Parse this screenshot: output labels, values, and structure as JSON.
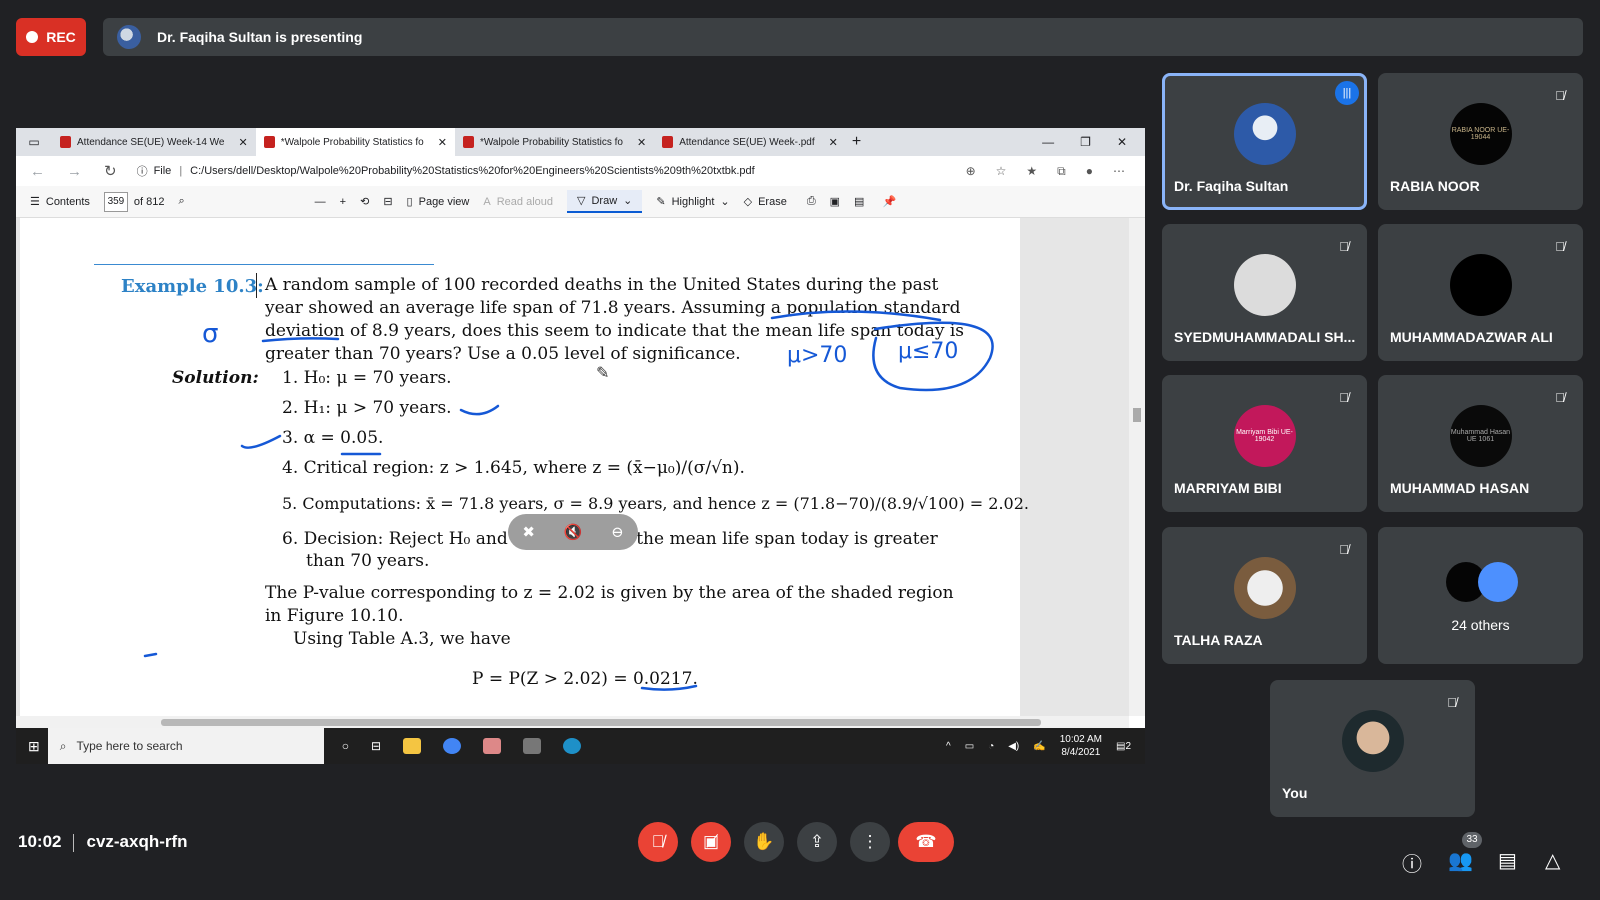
{
  "top": {
    "rec_label": "REC",
    "presenting_text": "Dr. Faqiha Sultan is presenting"
  },
  "browser": {
    "tabs": [
      {
        "label": "Attendance SE(UE) Week-14 We"
      },
      {
        "label": "*Walpole Probability Statistics fo"
      },
      {
        "label": "*Walpole Probability Statistics fo"
      },
      {
        "label": "Attendance SE(UE) Week-.pdf"
      }
    ],
    "address_prefix": "File",
    "url": "C:/Users/dell/Desktop/Walpole%20Probability%20Statistics%20for%20Engineers%20Scientists%209th%20txtbk.pdf"
  },
  "pdf_toolbar": {
    "contents": "Contents",
    "page": "359",
    "of_pages": "of 812",
    "page_view": "Page view",
    "read_aloud": "Read aloud",
    "draw": "Draw",
    "highlight": "Highlight",
    "erase": "Erase"
  },
  "document": {
    "example_heading": "Example 10.3:",
    "para1": [
      "A random sample of 100 recorded deaths in the United States during the past",
      "year showed an average life span of 71.8 years.  Assuming a population standard",
      "deviation of 8.9 years, does this seem to indicate that the mean life span today is",
      "greater than 70 years? Use a 0.05 level of significance."
    ],
    "solution_label": "Solution:",
    "steps": [
      "1.  H₀:  μ = 70 years.",
      "2.  H₁:  μ > 70 years.",
      "3.  α = 0.05.",
      "4.  Critical region: z > 1.645, where z = (x̄−μ₀)/(σ/√n).",
      "5.  Computations: x̄ = 71.8 years, σ = 8.9 years, and hence z = (71.8−70)/(8.9/√100) = 2.02.",
      "6.  Decision:  Reject H₀ and conclude that the mean life span today is greater",
      "than 70 years."
    ],
    "para2": [
      "The P-value corresponding to z = 2.02 is given by the area of the shaded region",
      "in Figure 10.10.",
      "Using Table A.3, we have"
    ],
    "formula": "P = P(Z > 2.02) = 0.0217.",
    "annotation_sigma": "σ",
    "annotation_mu1": "μ>70",
    "annotation_mu2": "μ≤70"
  },
  "taskbar": {
    "search_placeholder": "Type here to search",
    "time": "10:02 AM",
    "date": "8/4/2021",
    "notif_count": "2"
  },
  "participants": [
    {
      "name": "Dr. Faqiha Sultan"
    },
    {
      "name": "RABIA NOOR",
      "avatar_text": "RABIA NOOR UE-19044"
    },
    {
      "name": "SYEDMUHAMMADALI SH..."
    },
    {
      "name": "MUHAMMADAZWAR ALI"
    },
    {
      "name": "MARRIYAM BIBI",
      "avatar_text": "Marriyam Bibi UE-19042"
    },
    {
      "name": "MUHAMMAD HASAN",
      "avatar_text": "Muhammad Hasan UE 1061"
    },
    {
      "name": "TALHA RAZA"
    },
    {
      "others": "24 others"
    },
    {
      "name": "You"
    }
  ],
  "bottom": {
    "time": "10:02",
    "meeting_code": "cvz-axqh-rfn",
    "people_count": "33"
  }
}
